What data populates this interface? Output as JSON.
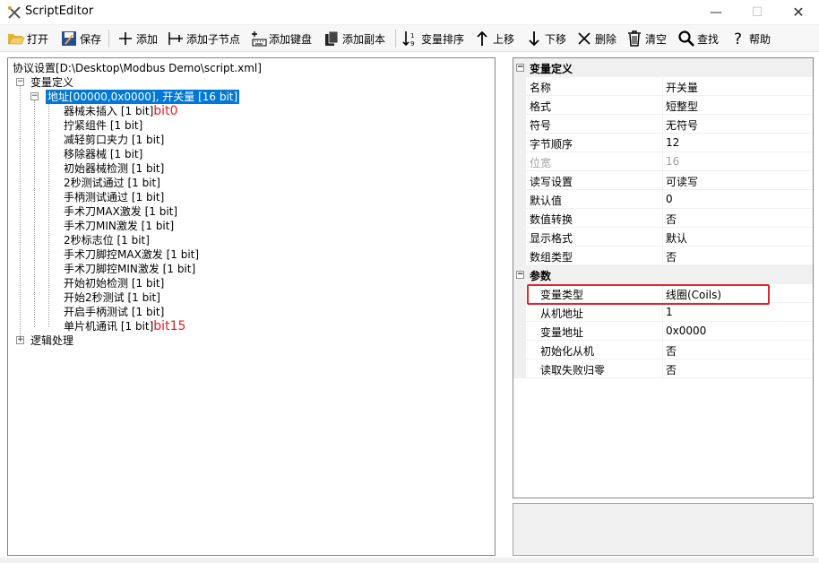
{
  "window": {
    "title": "ScriptEditor"
  },
  "toolbar": {
    "open": "打开",
    "save": "保存",
    "add": "添加",
    "add_child": "添加子节点",
    "add_key": "添加键盘",
    "add_copy": "添加副本",
    "sort": "变量排序",
    "move_up": "上移",
    "move_down": "下移",
    "delete": "删除",
    "clear": "清空",
    "find": "查找",
    "help": "帮助"
  },
  "tree": {
    "root": "协议设置[D:\\Desktop\\Modbus Demo\\script.xml]",
    "var_def": "变量定义",
    "selected": "地址[00000,0x0000], 开关量 [16 bit]",
    "items": [
      "器械未插入 [1 bit]",
      "拧紧组件 [1 bit]",
      "减轻剪口夹力 [1 bit]",
      "移除器械 [1 bit]",
      "初始器械检测 [1 bit]",
      "2秒测试通过 [1 bit]",
      "手柄测试通过 [1 bit]",
      "手术刀MAX激发 [1 bit]",
      "手术刀MIN激发 [1 bit]",
      "2秒标志位 [1 bit]",
      "手术刀脚控MAX激发 [1 bit]",
      "手术刀脚控MIN激发 [1 bit]",
      "开始初始检测 [1 bit]",
      "开始2秒测试 [1 bit]",
      "开启手柄测试 [1 bit]",
      "单片机通讯 [1 bit]"
    ],
    "annotation_first": "bit0",
    "annotation_last": "bit15",
    "logic": "逻辑处理"
  },
  "props": {
    "cat1": "变量定义",
    "rows1": [
      {
        "name": "名称",
        "value": "开关量"
      },
      {
        "name": "格式",
        "value": "短整型"
      },
      {
        "name": "符号",
        "value": "无符号"
      },
      {
        "name": "字节顺序",
        "value": "12"
      },
      {
        "name": "位宽",
        "value": "16"
      },
      {
        "name": "读写设置",
        "value": "可读写"
      },
      {
        "name": "默认值",
        "value": "0"
      },
      {
        "name": "数值转换",
        "value": "否"
      },
      {
        "name": "显示格式",
        "value": "默认"
      },
      {
        "name": "数组类型",
        "value": "否"
      }
    ],
    "cat2": "参数",
    "rows2": [
      {
        "name": "变量类型",
        "value": "线圈(Coils)"
      },
      {
        "name": "从机地址",
        "value": "1"
      },
      {
        "name": "变量地址",
        "value": "0x0000"
      },
      {
        "name": "初始化从机",
        "value": "否"
      },
      {
        "name": "读取失败归零",
        "value": "否"
      }
    ]
  },
  "colors": {
    "selection": "#0078d7",
    "annotation": "#e0202a"
  }
}
